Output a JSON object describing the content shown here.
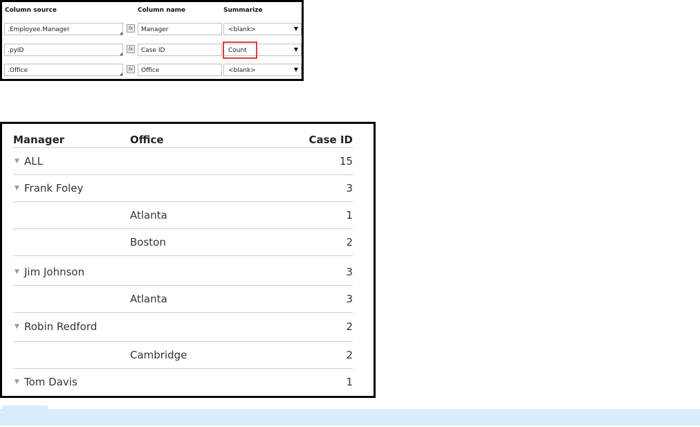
{
  "config": {
    "headers": {
      "source": "Column source",
      "name": "Column name",
      "summarize": "Summarize"
    },
    "rows": [
      {
        "source": ".Employee.Manager",
        "name": "Manager",
        "summarize": "<blank>"
      },
      {
        "source": ".pyID",
        "name": "Case ID",
        "summarize": "Count",
        "highlighted": true
      },
      {
        "source": ".Office",
        "name": "Office",
        "summarize": "<blank>"
      }
    ],
    "fx_icon": "fx",
    "dropdown_icon": "▼",
    "highlight_color": "#e0393a",
    "picker_accent_color": "#1a5fd0"
  },
  "report": {
    "headers": {
      "manager": "Manager",
      "office": "Office",
      "case_id": "Case ID"
    },
    "toggle_icon": "▼",
    "rows": [
      {
        "manager": "ALL",
        "office": "",
        "count": "15",
        "group": true
      },
      {
        "manager": "Frank Foley",
        "office": "",
        "count": "3",
        "group": true
      },
      {
        "manager": "",
        "office": "Atlanta",
        "count": "1",
        "group": false
      },
      {
        "manager": "",
        "office": "Boston",
        "count": "2",
        "group": false
      },
      {
        "manager": "Jim Johnson",
        "office": "",
        "count": "3",
        "group": true
      },
      {
        "manager": "",
        "office": "Atlanta",
        "count": "3",
        "group": false
      },
      {
        "manager": "Robin Redford",
        "office": "",
        "count": "2",
        "group": true
      },
      {
        "manager": "",
        "office": "Cambridge",
        "count": "2",
        "group": false
      },
      {
        "manager": "Tom Davis",
        "office": "",
        "count": "1",
        "group": true
      }
    ]
  },
  "info_bar_color": "#d8ecfb"
}
